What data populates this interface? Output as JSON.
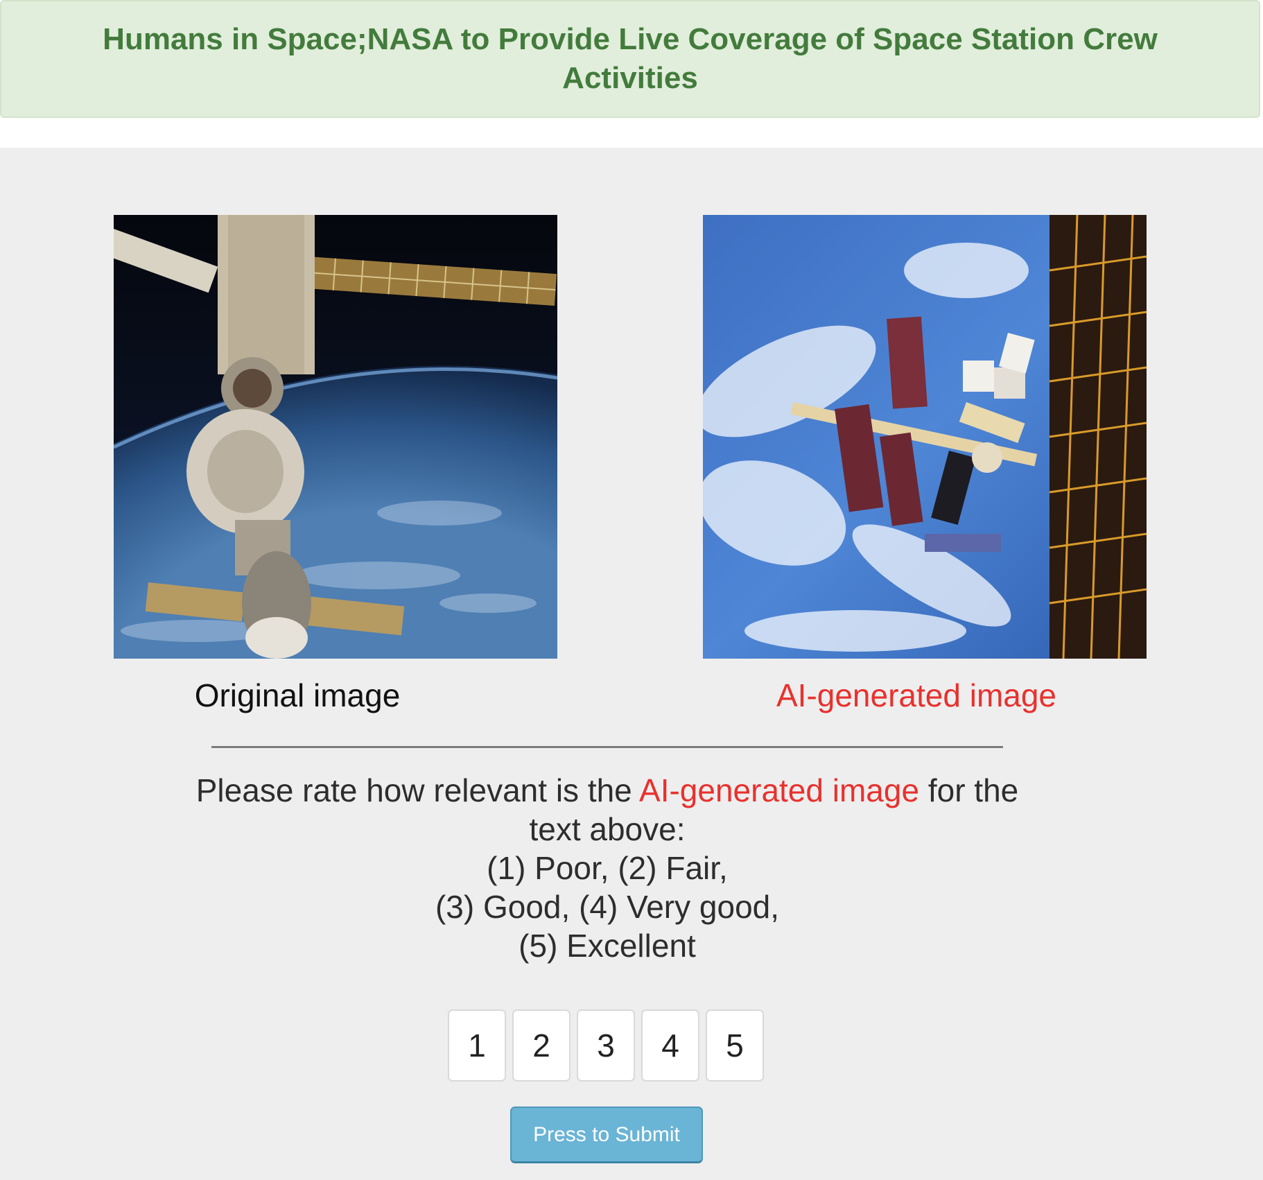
{
  "header": {
    "title": "Humans in Space;NASA to Provide Live Coverage of Space Station Crew Activities"
  },
  "images": {
    "original_caption": "Original image",
    "generated_caption": "AI-generated image"
  },
  "question": {
    "prefix": "Please rate how relevant is the ",
    "highlight": "AI-generated image",
    "suffix": " for the text above:",
    "scale_line1": "(1) Poor, (2) Fair,",
    "scale_line2": "(3) Good, (4) Very good,",
    "scale_line3": "(5) Excellent"
  },
  "ratings": [
    "1",
    "2",
    "3",
    "4",
    "5"
  ],
  "submit_label": "Press to Submit",
  "colors": {
    "header_bg": "#e1eedb",
    "header_text": "#437b3d",
    "highlight": "#e8312d",
    "submit_bg": "#6ab4d6"
  }
}
